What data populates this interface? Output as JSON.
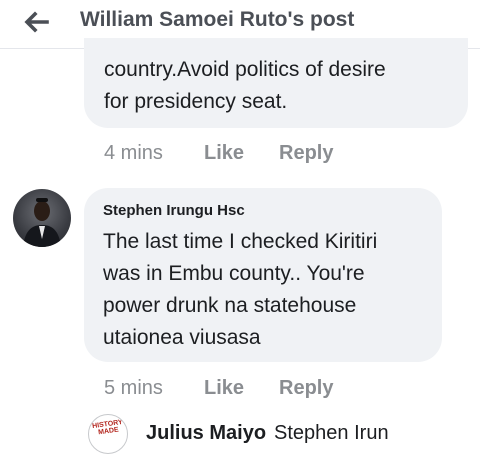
{
  "header": {
    "title": "William Samoei Ruto's post",
    "back_icon": "arrow-left-icon"
  },
  "comments": [
    {
      "text": "country.Avoid politics of desire\nfor  presidency seat.",
      "time": "4 mins",
      "like_label": "Like",
      "reply_label": "Reply"
    },
    {
      "author": "Stephen Irungu Hsc",
      "text": "The last time I checked Kiritiri\nwas in Embu county.. You're\npower drunk na statehouse\nutaionea viusasa",
      "time": "5 mins",
      "like_label": "Like",
      "reply_label": "Reply"
    }
  ],
  "reply_preview": {
    "author": "Julius Maiyo",
    "text": "Stephen Irun",
    "avatar_badge": "HISTORY MADE"
  },
  "colors": {
    "bubble": "#f0f2f5",
    "meta_text": "#8a8d91",
    "header_text": "#4b4f56"
  }
}
